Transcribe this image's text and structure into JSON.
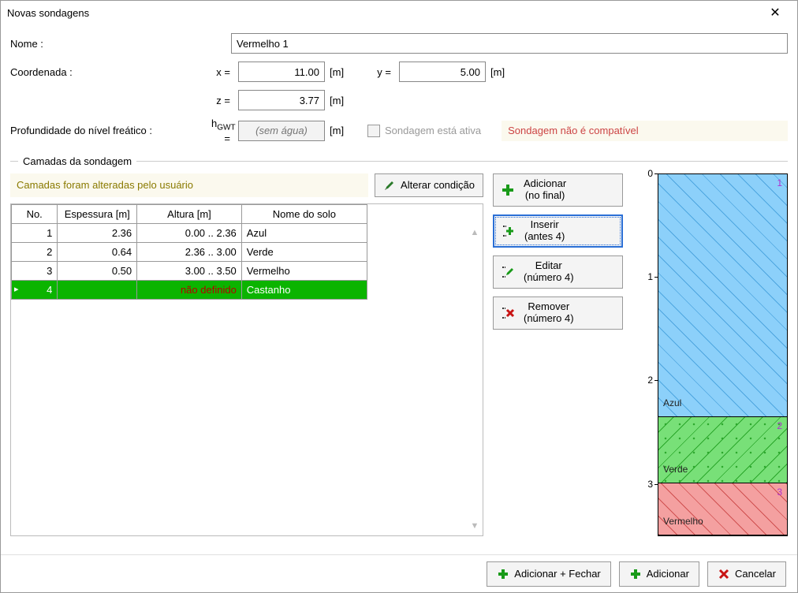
{
  "window": {
    "title": "Novas sondagens"
  },
  "form": {
    "name_label": "Nome :",
    "name_value": "Vermelho 1",
    "coord_label": "Coordenada :",
    "x_label": "x =",
    "x_value": "11.00",
    "x_unit": "[m]",
    "y_label": "y =",
    "y_value": "5.00",
    "y_unit": "[m]",
    "z_label": "z =",
    "z_value": "3.77",
    "z_unit": "[m]",
    "gwt_label": "Profundidade do nível freático :",
    "gwt_sym_pre": "h",
    "gwt_sym_sub": "GWT",
    "gwt_eq": " =",
    "gwt_placeholder": "(sem água)",
    "gwt_unit": "[m]",
    "active_label": "Sondagem está ativa",
    "error": "Sondagem não é compatível"
  },
  "section": {
    "title": "Camadas da sondagem"
  },
  "notice": "Camadas foram alteradas pelo usuário",
  "alter_btn": "Alterar condição",
  "table": {
    "headers": {
      "no": "No.",
      "esp": "Espessura [m]",
      "alt": "Altura [m]",
      "nome": "Nome do solo"
    },
    "rows": [
      {
        "no": "1",
        "esp": "2.36",
        "alt": "0.00 .. 2.36",
        "nome": "Azul",
        "sel": false
      },
      {
        "no": "2",
        "esp": "0.64",
        "alt": "2.36 .. 3.00",
        "nome": "Verde",
        "sel": false
      },
      {
        "no": "3",
        "esp": "0.50",
        "alt": "3.00 .. 3.50",
        "nome": "Vermelho",
        "sel": false
      },
      {
        "no": "4",
        "esp": "",
        "alt": "não definido",
        "nome": "Castanho",
        "sel": true
      }
    ]
  },
  "actions": {
    "add": {
      "l1": "Adicionar",
      "l2": "(no final)"
    },
    "insert": {
      "l1": "Inserir",
      "l2": "(antes 4)"
    },
    "edit": {
      "l1": "Editar",
      "l2": "(número 4)"
    },
    "remove": {
      "l1": "Remover",
      "l2": "(número 4)"
    }
  },
  "profile": {
    "axis": [
      0,
      1,
      2,
      3
    ],
    "total_depth": 3.5,
    "layers": [
      {
        "n": "1",
        "name": "Azul",
        "top": 0.0,
        "bot": 2.36,
        "cls": "hatch-blue"
      },
      {
        "n": "2",
        "name": "Verde",
        "top": 2.36,
        "bot": 3.0,
        "cls": "hatch-green"
      },
      {
        "n": "3",
        "name": "Vermelho",
        "top": 3.0,
        "bot": 3.5,
        "cls": "hatch-red"
      }
    ]
  },
  "footer": {
    "add_close": "Adicionar + Fechar",
    "add": "Adicionar",
    "cancel": "Cancelar"
  }
}
